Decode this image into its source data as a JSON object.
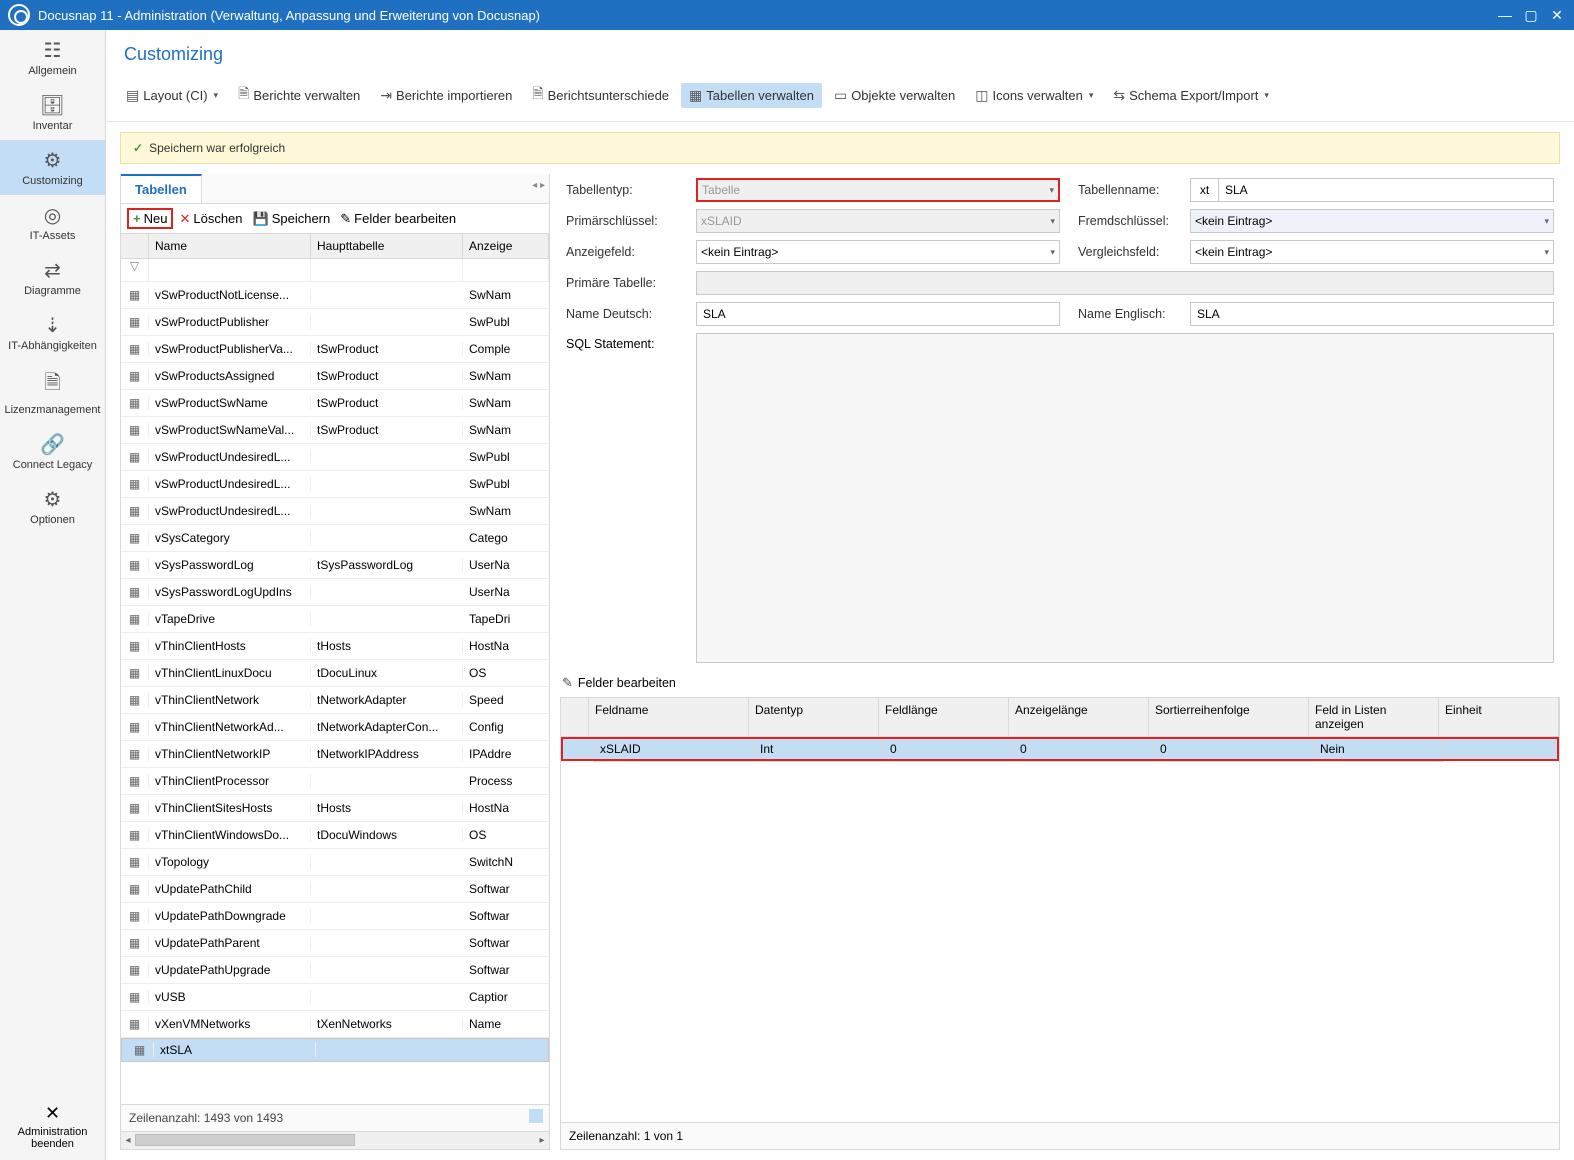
{
  "titlebar": {
    "text": "Docusnap 11 - Administration (Verwaltung, Anpassung und Erweiterung von Docusnap)"
  },
  "sidebar": {
    "items": [
      {
        "label": "Allgemein"
      },
      {
        "label": "Inventar"
      },
      {
        "label": "Customizing"
      },
      {
        "label": "IT-Assets"
      },
      {
        "label": "Diagramme"
      },
      {
        "label": "IT-Abhängigkeiten"
      },
      {
        "label": "Lizenzmanagement"
      },
      {
        "label": "Connect Legacy"
      },
      {
        "label": "Optionen"
      }
    ],
    "exit": "Administration beenden"
  },
  "section_header": "Customizing",
  "toolbar": {
    "layout": "Layout (CI)",
    "reports_manage": "Berichte verwalten",
    "reports_import": "Berichte importieren",
    "reports_diff": "Berichtsunterschiede",
    "tables_manage": "Tabellen verwalten",
    "objects_manage": "Objekte verwalten",
    "icons_manage": "Icons verwalten",
    "schema": "Schema Export/Import"
  },
  "status_msg": "Speichern war erfolgreich",
  "tabs": {
    "tabellen": "Tabellen"
  },
  "lp_toolbar": {
    "neu": "Neu",
    "loeschen": "Löschen",
    "speichern": "Speichern",
    "felder": "Felder bearbeiten"
  },
  "grid_headers": {
    "name": "Name",
    "main": "Haupttabelle",
    "disp": "Anzeige"
  },
  "grid_rows": [
    {
      "name": "vSwProductNotLicense...",
      "main": "",
      "disp": "SwNam"
    },
    {
      "name": "vSwProductPublisher",
      "main": "",
      "disp": "SwPubl"
    },
    {
      "name": "vSwProductPublisherVa...",
      "main": "tSwProduct",
      "disp": "Comple"
    },
    {
      "name": "vSwProductsAssigned",
      "main": "tSwProduct",
      "disp": "SwNam"
    },
    {
      "name": "vSwProductSwName",
      "main": "tSwProduct",
      "disp": "SwNam"
    },
    {
      "name": "vSwProductSwNameVal...",
      "main": "tSwProduct",
      "disp": "SwNam"
    },
    {
      "name": "vSwProductUndesiredL...",
      "main": "",
      "disp": "SwPubl"
    },
    {
      "name": "vSwProductUndesiredL...",
      "main": "",
      "disp": "SwPubl"
    },
    {
      "name": "vSwProductUndesiredL...",
      "main": "",
      "disp": "SwNam"
    },
    {
      "name": "vSysCategory",
      "main": "",
      "disp": "Catego"
    },
    {
      "name": "vSysPasswordLog",
      "main": "tSysPasswordLog",
      "disp": "UserNa"
    },
    {
      "name": "vSysPasswordLogUpdIns",
      "main": "",
      "disp": "UserNa"
    },
    {
      "name": "vTapeDrive",
      "main": "",
      "disp": "TapeDri"
    },
    {
      "name": "vThinClientHosts",
      "main": "tHosts",
      "disp": "HostNa"
    },
    {
      "name": "vThinClientLinuxDocu",
      "main": "tDocuLinux",
      "disp": "OS"
    },
    {
      "name": "vThinClientNetwork",
      "main": "tNetworkAdapter",
      "disp": "Speed"
    },
    {
      "name": "vThinClientNetworkAd...",
      "main": "tNetworkAdapterCon...",
      "disp": "Config"
    },
    {
      "name": "vThinClientNetworkIP",
      "main": "tNetworkIPAddress",
      "disp": "IPAddre"
    },
    {
      "name": "vThinClientProcessor",
      "main": "",
      "disp": "Process"
    },
    {
      "name": "vThinClientSitesHosts",
      "main": "tHosts",
      "disp": "HostNa"
    },
    {
      "name": "vThinClientWindowsDo...",
      "main": "tDocuWindows",
      "disp": "OS"
    },
    {
      "name": "vTopology",
      "main": "",
      "disp": "SwitchN"
    },
    {
      "name": "vUpdatePathChild",
      "main": "",
      "disp": "Softwar"
    },
    {
      "name": "vUpdatePathDowngrade",
      "main": "",
      "disp": "Softwar"
    },
    {
      "name": "vUpdatePathParent",
      "main": "",
      "disp": "Softwar"
    },
    {
      "name": "vUpdatePathUpgrade",
      "main": "",
      "disp": "Softwar"
    },
    {
      "name": "vUSB",
      "main": "",
      "disp": "Captior"
    },
    {
      "name": "vXenVMNetworks",
      "main": "tXenNetworks",
      "disp": "Name"
    },
    {
      "name": "xtSLA",
      "main": "",
      "disp": ""
    }
  ],
  "selected_row_index": 28,
  "grid_footer": "Zeilenanzahl: 1493 von 1493",
  "form": {
    "tabellentyp_lbl": "Tabellentyp:",
    "tabellentyp_val": "Tabelle",
    "tabellenname_lbl": "Tabellenname:",
    "tabellenname_prefix": "xt",
    "tabellenname_val": "SLA",
    "primar_lbl": "Primärschlüssel:",
    "primar_val": "xSLAID",
    "fremd_lbl": "Fremdschlüssel:",
    "fremd_val": "<kein Eintrag>",
    "anzeige_lbl": "Anzeigefeld:",
    "anzeige_val": "<kein Eintrag>",
    "vergleich_lbl": "Vergleichsfeld:",
    "vergleich_val": "<kein Eintrag>",
    "primtab_lbl": "Primäre Tabelle:",
    "primtab_val": "",
    "name_de_lbl": "Name Deutsch:",
    "name_de_val": "SLA",
    "name_en_lbl": "Name Englisch:",
    "name_en_val": "SLA",
    "sql_lbl": "SQL Statement:"
  },
  "fields_header": "Felder bearbeiten",
  "fields_grid": {
    "headers": {
      "feldname": "Feldname",
      "datentyp": "Datentyp",
      "feldlaenge": "Feldlänge",
      "anzeigelaenge": "Anzeigelänge",
      "sortier": "Sortierreihenfolge",
      "listen": "Feld in Listen anzeigen",
      "einheit": "Einheit"
    },
    "row": {
      "feldname": "xSLAID",
      "datentyp": "Int",
      "feldlaenge": "0",
      "anzeigelaenge": "0",
      "sortier": "0",
      "listen": "Nein",
      "einheit": ""
    },
    "footer": "Zeilenanzahl: 1 von 1"
  }
}
